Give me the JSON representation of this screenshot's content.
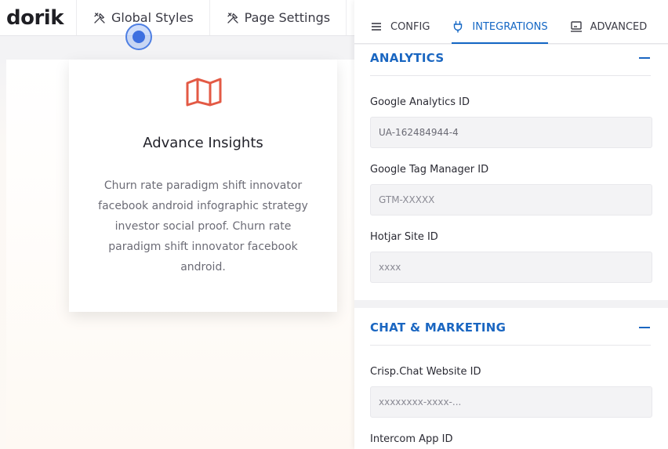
{
  "topbar": {
    "logo_text": "dorik",
    "global_styles_label": "Global Styles",
    "page_settings_label": "Page Settings"
  },
  "card": {
    "icon": "map-icon",
    "title": "Advance Insights",
    "body": "Churn rate paradigm shift innovator facebook android infographic strategy investor social proof. Churn rate paradigm shift innovator facebook android."
  },
  "panel": {
    "tabs": [
      {
        "label": "CONFIG",
        "icon": "hamburger-icon",
        "active": false
      },
      {
        "label": "INTEGRATIONS",
        "icon": "plug-icon",
        "active": true
      },
      {
        "label": "ADVANCED",
        "icon": "monitor-icon",
        "active": false
      }
    ],
    "analytics": {
      "title": "ANALYTICS",
      "fields": [
        {
          "label": "Google Analytics ID",
          "value": "UA-162484944-4",
          "placeholder": ""
        },
        {
          "label": "Google Tag Manager ID",
          "value": "",
          "placeholder": "GTM-XXXXX"
        },
        {
          "label": "Hotjar Site ID",
          "value": "",
          "placeholder": "xxxx"
        }
      ]
    },
    "chat": {
      "title": "CHAT & MARKETING",
      "fields": [
        {
          "label": "Crisp.Chat Website ID",
          "value": "",
          "placeholder": "xxxxxxxx-xxxx-..."
        },
        {
          "label": "Intercom App ID"
        }
      ]
    }
  },
  "colors": {
    "accent": "#1366c4",
    "map_icon": "#e35a45",
    "cursor": "#3d6fe0"
  }
}
